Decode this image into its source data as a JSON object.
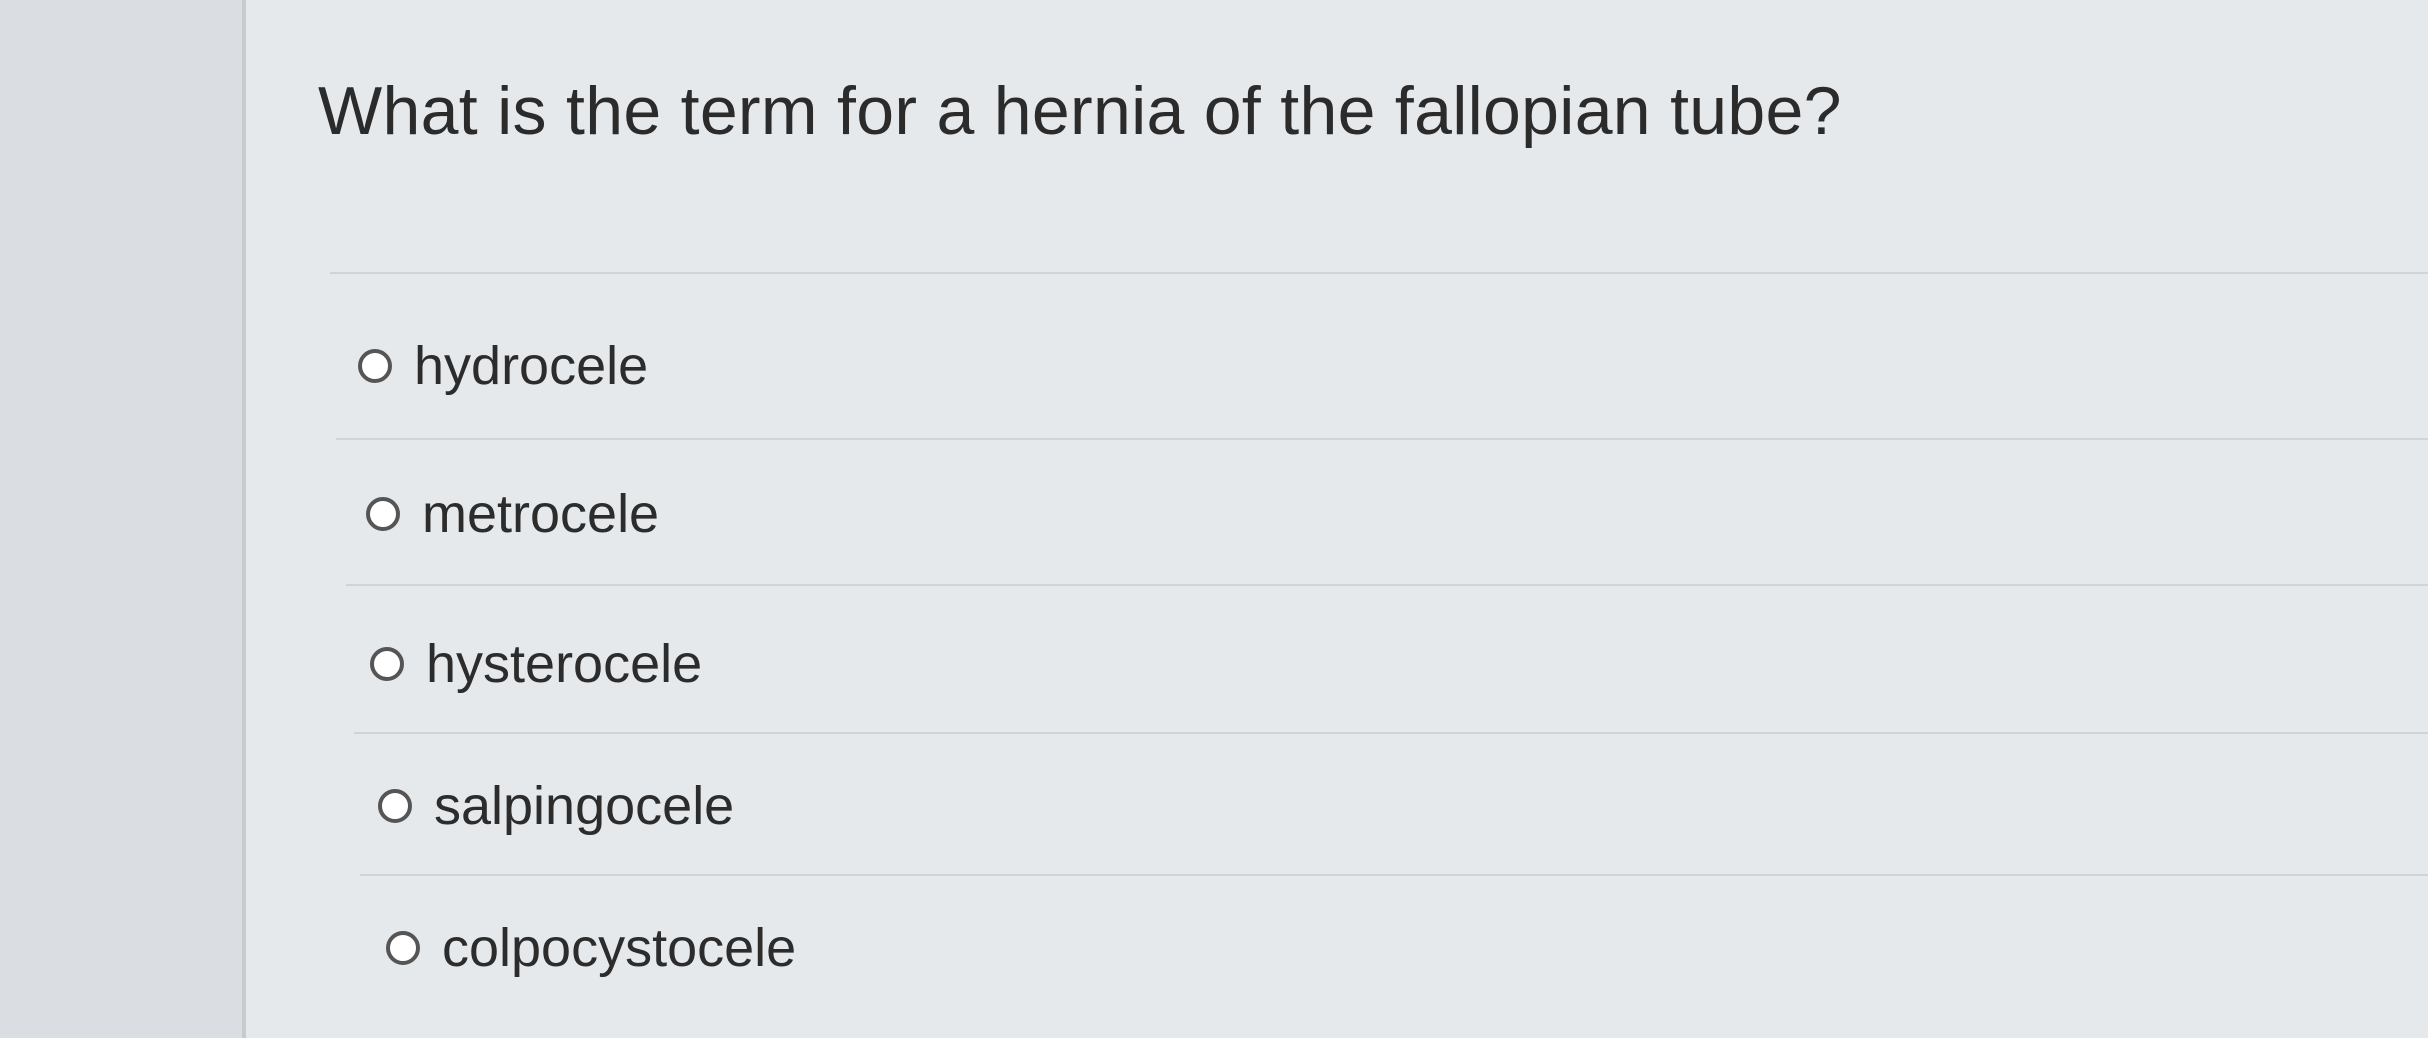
{
  "question": {
    "text": "What is the term for a hernia of the fallopian tube?"
  },
  "options": [
    {
      "label": "hydrocele"
    },
    {
      "label": "metrocele"
    },
    {
      "label": "hysterocele"
    },
    {
      "label": "salpingocele"
    },
    {
      "label": "colpocystocele"
    }
  ]
}
